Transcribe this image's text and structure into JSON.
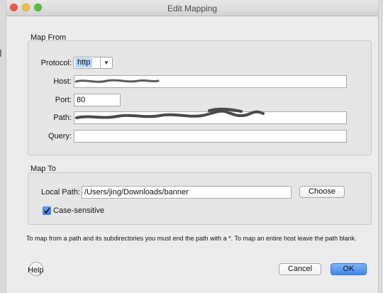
{
  "window": {
    "title": "Edit Mapping"
  },
  "map_from": {
    "group_label": "Map From",
    "protocol_label": "Protocol:",
    "protocol_value": "http",
    "host_label": "Host:",
    "host_value": "",
    "port_label": "Port:",
    "port_value": "80",
    "path_label": "Path:",
    "path_value": "",
    "query_label": "Query:",
    "query_value": ""
  },
  "map_to": {
    "group_label": "Map To",
    "local_path_label": "Local Path:",
    "local_path_value": "/Users/jing/Downloads/banner",
    "choose_label": "Choose",
    "case_sensitive_label": "Case-sensitive",
    "case_sensitive_checked": true
  },
  "hint_text": "To map from a path and its subdirectories you must end the path with a *. To map an entire host leave the path blank.",
  "footer": {
    "help_label": "Help",
    "cancel_label": "Cancel",
    "ok_label": "OK"
  }
}
